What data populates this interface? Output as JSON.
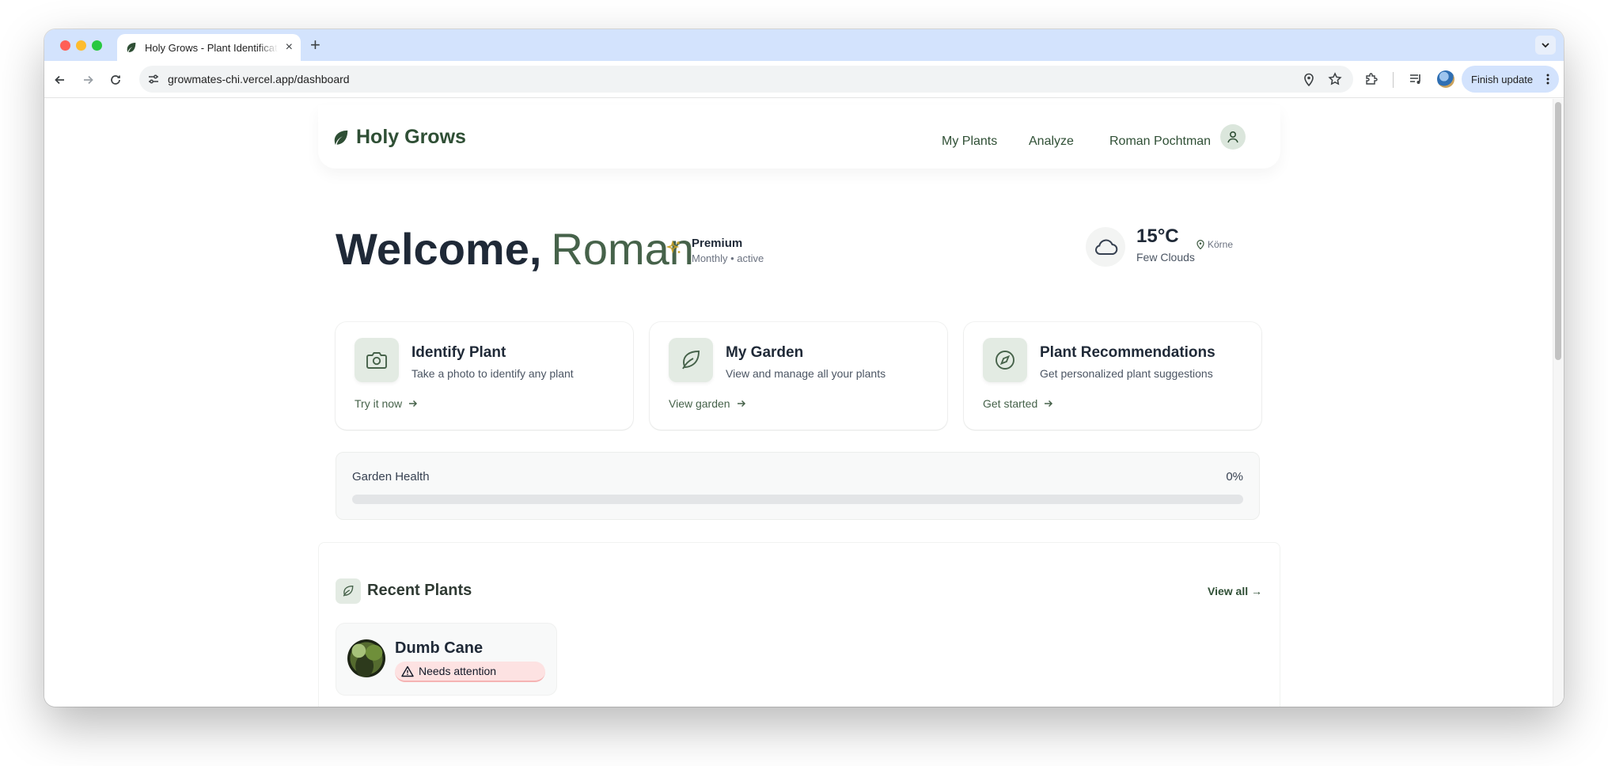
{
  "browser": {
    "tab_title": "Holy Grows - Plant Identification",
    "url": "growmates-chi.vercel.app/dashboard",
    "finish_update_label": "Finish update"
  },
  "header": {
    "brand": "Holy Grows",
    "nav": [
      "My Plants",
      "Analyze"
    ],
    "user_name": "Roman Pochtman"
  },
  "welcome": {
    "greeting": "Welcome,",
    "name": "Roman",
    "plan_title": "Premium",
    "plan_subtitle": "Monthly • active"
  },
  "weather": {
    "temperature": "15°C",
    "condition": "Few Clouds",
    "location": "Körne"
  },
  "cards": [
    {
      "title": "Identify Plant",
      "description": "Take a photo to identify any plant",
      "link": "Try it now",
      "icon": "camera-icon"
    },
    {
      "title": "My Garden",
      "description": "View and manage all your plants",
      "link": "View garden",
      "icon": "leaf-icon"
    },
    {
      "title": "Plant Recommendations",
      "description": "Get personalized plant suggestions",
      "link": "Get started",
      "icon": "compass-icon"
    }
  ],
  "garden_health": {
    "label": "Garden Health",
    "value_text": "0%",
    "value": 0
  },
  "recent_plants": {
    "title": "Recent Plants",
    "view_all": "View all →",
    "items": [
      {
        "name": "Dumb Cane",
        "status": "Needs attention"
      }
    ]
  },
  "colors": {
    "brand_green": "#2f4f35",
    "accent_sage": "#46624a",
    "chrome_blue": "#d3e3fd",
    "attention_bg": "#fde2e2"
  }
}
